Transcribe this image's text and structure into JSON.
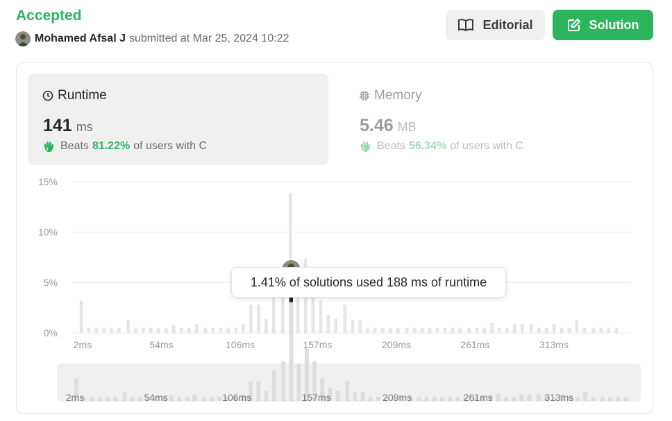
{
  "status": "Accepted",
  "submitter": {
    "name": "Mohamed Afsal J",
    "text": "submitted at Mar 25, 2024 10:22"
  },
  "buttons": {
    "editorial": "Editorial",
    "solution": "Solution"
  },
  "runtime": {
    "title": "Runtime",
    "value": "141",
    "unit": "ms",
    "beats_label": "Beats",
    "beats_pct": "81.22%",
    "beats_suffix": "of users with C"
  },
  "memory": {
    "title": "Memory",
    "value": "5.46",
    "unit": "MB",
    "beats_label": "Beats",
    "beats_pct": "56.34%",
    "beats_suffix": "of users with C"
  },
  "tooltip": "1.41% of solutions used 188 ms of runtime",
  "colors": {
    "accent": "#2db55d",
    "bar": "#e6e6e6",
    "highlight": "#1a1a1a",
    "grid": "#ececec"
  },
  "chart_data": {
    "type": "bar",
    "xlabel": "",
    "ylabel": "",
    "ylim": [
      0,
      15
    ],
    "y_ticks": [
      "15%",
      "10%",
      "5%",
      "0%"
    ],
    "y_tick_values": [
      15,
      10,
      5,
      0
    ],
    "x_ticks": [
      "2ms",
      "54ms",
      "106ms",
      "157ms",
      "209ms",
      "261ms",
      "313ms"
    ],
    "x_tick_values": [
      2,
      54,
      106,
      157,
      209,
      261,
      313
    ],
    "x": [
      2,
      7,
      12,
      17,
      22,
      27,
      33,
      38,
      43,
      48,
      53,
      58,
      63,
      68,
      73,
      78,
      84,
      89,
      94,
      99,
      104,
      109,
      114,
      119,
      124,
      129,
      135,
      140,
      145,
      150,
      155,
      160,
      165,
      170,
      176,
      181,
      186,
      191,
      196,
      201,
      206,
      211,
      217,
      222,
      227,
      232,
      237,
      242,
      247,
      252,
      258,
      263,
      268,
      273,
      278,
      283,
      288,
      293,
      299,
      304,
      309,
      314,
      319,
      324,
      329,
      334,
      340,
      345,
      350,
      355
    ],
    "values": [
      3.2,
      0.5,
      0.5,
      0.5,
      0.5,
      0.5,
      1.3,
      0.5,
      0.5,
      0.5,
      0.5,
      0.5,
      0.8,
      0.5,
      0.5,
      0.9,
      0.5,
      0.5,
      0.5,
      0.5,
      0.5,
      0.9,
      2.8,
      2.8,
      1.4,
      4.3,
      5.6,
      13.9,
      5.2,
      7.4,
      5.6,
      3.2,
      1.8,
      1.4,
      2.8,
      1.3,
      1.3,
      0.5,
      0.5,
      0.5,
      0.5,
      0.5,
      0.5,
      0.5,
      0.5,
      0.5,
      0.5,
      0.5,
      0.5,
      0.5,
      0.5,
      0.5,
      0.5,
      1.0,
      0.5,
      0.5,
      0.9,
      0.9,
      0.9,
      0.5,
      0.5,
      0.9,
      0.5,
      0.5,
      1.3,
      0.5,
      0.5,
      0.5,
      0.5,
      0.5
    ],
    "highlight": {
      "x": 188,
      "value": 5.0
    },
    "user_marker_x": 141
  }
}
